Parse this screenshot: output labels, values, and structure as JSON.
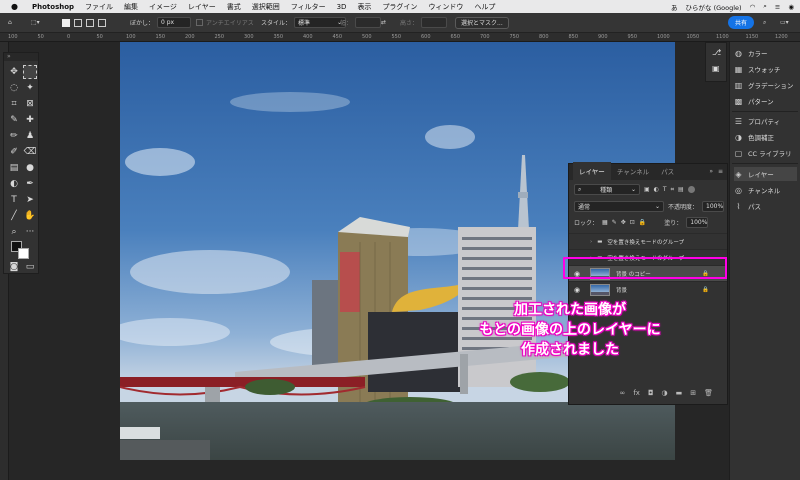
{
  "menubar": {
    "app_name": "Photoshop",
    "items": [
      "ファイル",
      "編集",
      "イメージ",
      "レイヤー",
      "書式",
      "選択範囲",
      "フィルター",
      "3D",
      "表示",
      "プラグイン",
      "ウィンドウ",
      "ヘルプ"
    ],
    "input_source": "ひらがな (Google)"
  },
  "options": {
    "feather_label": "ぼかし：",
    "feather_value": "0 px",
    "antialias_label": "アンチエイリアス",
    "style_label": "スタイル：",
    "style_value": "標準",
    "width_label": "幅：",
    "height_label": "高さ：",
    "select_mask_button": "選択とマスク...",
    "share_button": "共有"
  },
  "ruler": {
    "ticks": [
      "100",
      "50",
      "0",
      "50",
      "100",
      "150",
      "200",
      "250",
      "300",
      "350",
      "400",
      "450",
      "500",
      "550",
      "600",
      "650",
      "700",
      "750",
      "800",
      "850",
      "900",
      "950",
      "1000",
      "1050",
      "1100",
      "1150",
      "1200"
    ]
  },
  "right_dock": {
    "items": [
      {
        "label": "カラー",
        "icon": "color-wheel-icon"
      },
      {
        "label": "スウォッチ",
        "icon": "swatches-icon"
      },
      {
        "label": "グラデーション",
        "icon": "gradient-icon"
      },
      {
        "label": "パターン",
        "icon": "pattern-icon"
      },
      {
        "label": "プロパティ",
        "icon": "properties-icon"
      },
      {
        "label": "色調補正",
        "icon": "adjustments-icon"
      },
      {
        "label": "CC ライブラリ",
        "icon": "library-icon"
      },
      {
        "label": "レイヤー",
        "icon": "layers-icon"
      },
      {
        "label": "チャンネル",
        "icon": "channels-icon"
      },
      {
        "label": "パス",
        "icon": "paths-icon"
      }
    ]
  },
  "layers_panel": {
    "tabs": [
      "レイヤー",
      "チャンネル",
      "パス"
    ],
    "filter_kind": "種類",
    "blend_mode": "通常",
    "opacity_label": "不透明度：",
    "opacity_value": "100%",
    "lock_label": "ロック：",
    "fill_label": "塗り：",
    "fill_value": "100%",
    "layers": [
      {
        "name": "空を置き換えモードのグループ",
        "type": "group",
        "visible": false
      },
      {
        "name": "空を置き換えモードのグループ",
        "type": "group",
        "visible": false
      },
      {
        "name": "背景 のコピー",
        "type": "pixel",
        "visible": true,
        "locked": true
      },
      {
        "name": "背景",
        "type": "pixel",
        "visible": true,
        "locked": true
      }
    ]
  },
  "annotation": {
    "lines": [
      "加工された画像が",
      "もとの画像の上のレイヤーに",
      "作成されました"
    ],
    "color": "#ff00e6"
  }
}
